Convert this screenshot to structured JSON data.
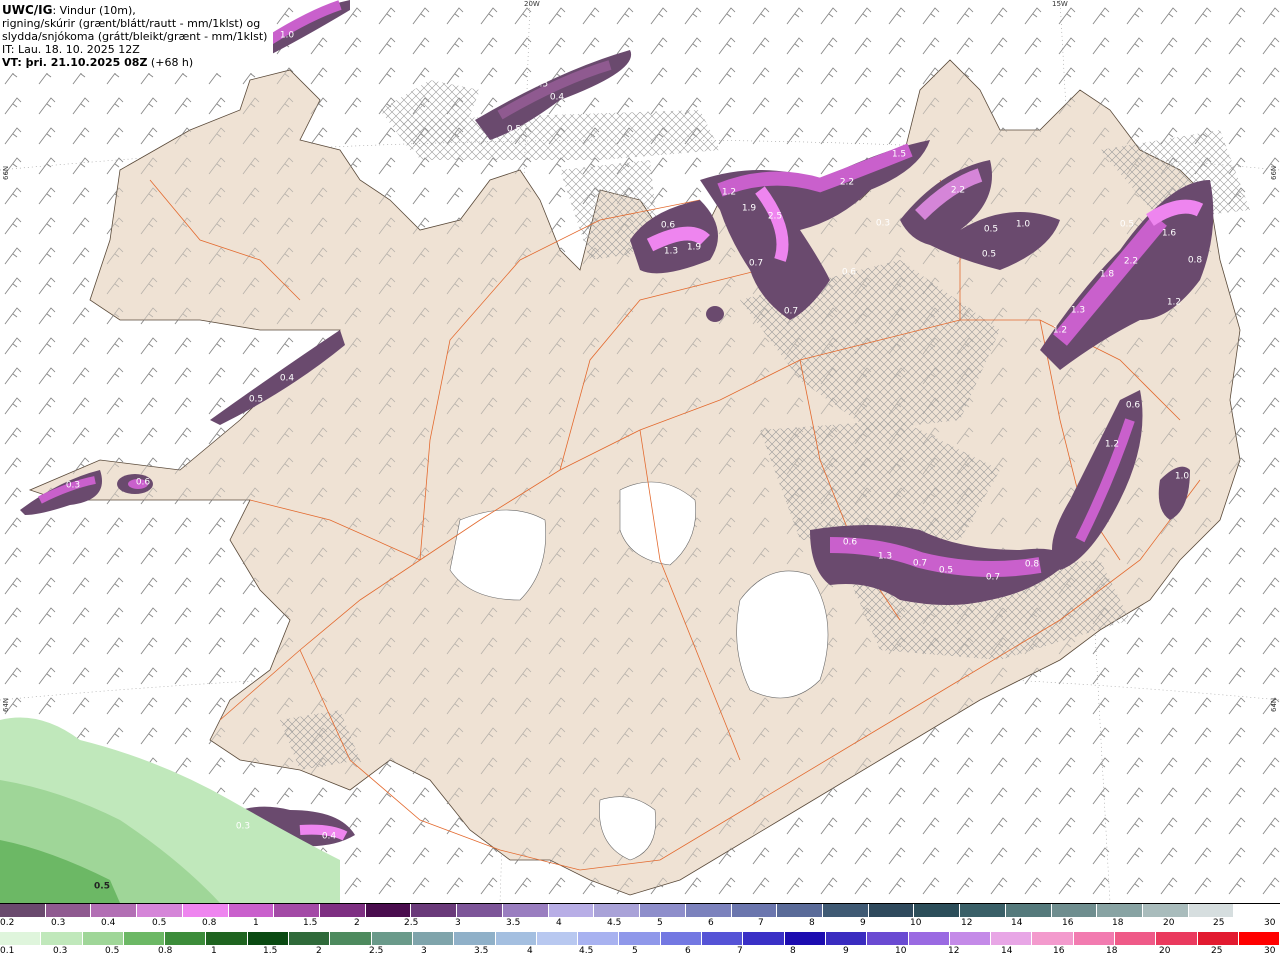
{
  "header": {
    "brand": "UWC/IG",
    "line1_rest": ": Vindur (10m),",
    "line2": "rigning/skúrir (grænt/blátt/rautt - mm/1klst) og",
    "line3": "slydda/snjókoma (grátt/bleikt/grænt - mm/1klst)",
    "line4": "IT: Lau. 18. 10. 2025 12Z",
    "vt_label": "VT: þri. 21.10.2025 08Z",
    "vt_rest": " (+68 h)"
  },
  "coords": {
    "top_left": "20W",
    "top_right": "15W",
    "left_upper": "66N",
    "left_lower": "64N",
    "right_upper": "66N",
    "right_lower": "64N"
  },
  "precip_labels": [
    {
      "text": "1.0"
    },
    {
      "text": "0.3"
    },
    {
      "text": "0.5"
    },
    {
      "text": "0.4"
    },
    {
      "text": "0.5"
    },
    {
      "text": "0.4"
    },
    {
      "text": "0.5"
    },
    {
      "text": "0.3"
    },
    {
      "text": "0.6"
    },
    {
      "text": "1.2"
    },
    {
      "text": "1.9"
    },
    {
      "text": "2.5"
    },
    {
      "text": "2.2"
    },
    {
      "text": "1.5"
    },
    {
      "text": "0.3"
    },
    {
      "text": "2.2"
    },
    {
      "text": "0.5"
    },
    {
      "text": "1.0"
    },
    {
      "text": "0.5"
    },
    {
      "text": "0.6"
    },
    {
      "text": "1.3"
    },
    {
      "text": "1.9"
    },
    {
      "text": "0.7"
    },
    {
      "text": "0.6"
    },
    {
      "text": "0.7"
    },
    {
      "text": "0.5"
    },
    {
      "text": "1.6"
    },
    {
      "text": "2.2"
    },
    {
      "text": "1.8"
    },
    {
      "text": "0.8"
    },
    {
      "text": "1.3"
    },
    {
      "text": "1.2"
    },
    {
      "text": "1.2"
    },
    {
      "text": "1.2"
    },
    {
      "text": "0.6"
    },
    {
      "text": "1.0"
    },
    {
      "text": "0.6"
    },
    {
      "text": "1.3"
    },
    {
      "text": "0.7"
    },
    {
      "text": "0.5"
    },
    {
      "text": "0.7"
    },
    {
      "text": "0.8"
    },
    {
      "text": "0.3"
    },
    {
      "text": "0.4"
    },
    {
      "text": "0.5"
    }
  ],
  "legend_snow": {
    "colors": [
      "#6a4a6e",
      "#8f5a90",
      "#b26fb4",
      "#d585d8",
      "#ee85ef",
      "#c960cc",
      "#a34aa6",
      "#7e2f82",
      "#4a0d4e",
      "#6a3a7a",
      "#7d5599",
      "#9a7ec0",
      "#b8aee6",
      "#a9a2d8",
      "#8e8ecb",
      "#7c82bd",
      "#6b76ae",
      "#5a6b99",
      "#3f5a74",
      "#2f4a5d",
      "#2c4e5a",
      "#3a6068",
      "#557a7c",
      "#6f8e8f",
      "#88a3a3",
      "#a9bcbc",
      "#d6dedf",
      "#ffffff"
    ],
    "ticks": [
      "0.2",
      "0.3",
      "0.4",
      "0.5",
      "0.8",
      "1",
      "1.5",
      "2",
      "2.5",
      "3",
      "3.5",
      "4",
      "4.5",
      "5",
      "6",
      "7",
      "8",
      "9",
      "10",
      "12",
      "14",
      "16",
      "18",
      "20",
      "25",
      "30"
    ]
  },
  "legend_rain": {
    "colors": [
      "#dff5dc",
      "#c0e8bb",
      "#9fd698",
      "#6cb865",
      "#3c8c3a",
      "#1f6420",
      "#0a4a12",
      "#2f6a3a",
      "#4d8a5e",
      "#6a9a8a",
      "#7fa4ab",
      "#8fb0c8",
      "#a4bfe0",
      "#b8c8f0",
      "#a8b2f0",
      "#8f98ea",
      "#7378e2",
      "#5553d6",
      "#3a30c6",
      "#1c0cb0",
      "#3a2cc0",
      "#6a4ad2",
      "#9a6ae2",
      "#c48ae8",
      "#e8a6e6",
      "#f39acd",
      "#f27bb0",
      "#ef5a88",
      "#ea3a5e",
      "#e21a30",
      "#ff0000"
    ],
    "ticks": [
      "0.1",
      "0.3",
      "0.5",
      "0.8",
      "1",
      "1.5",
      "2",
      "2.5",
      "3",
      "3.5",
      "4",
      "4.5",
      "5",
      "6",
      "7",
      "8",
      "9",
      "10",
      "12",
      "14",
      "16",
      "18",
      "20",
      "25",
      "30"
    ]
  },
  "colors": {
    "land": "#efe2d4",
    "sea": "#ffffff",
    "road": "#e36a2f",
    "coast": "#5a4a3a",
    "barb": "#777777",
    "cloud_hatch": "#bfbfbf"
  }
}
